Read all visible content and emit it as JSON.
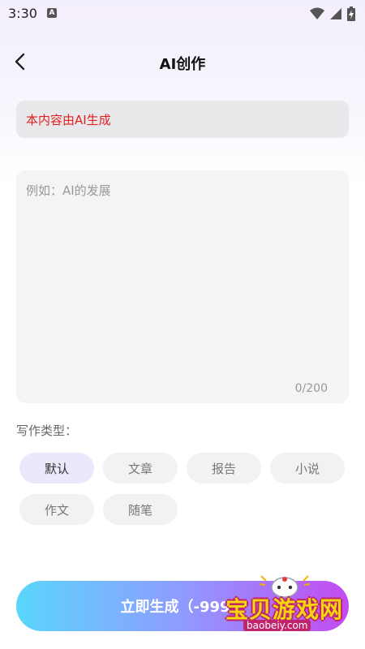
{
  "status": {
    "time": "3:30",
    "a_badge": "A"
  },
  "header": {
    "title": "AI创作"
  },
  "notice": {
    "text": "本内容由AI生成"
  },
  "editor": {
    "placeholder": "例如：AI的发展",
    "value": "",
    "counter": "0/200"
  },
  "writing_type": {
    "label": "写作类型：",
    "options": [
      "默认",
      "文章",
      "报告",
      "小说",
      "作文",
      "随笔"
    ],
    "selected": "默认"
  },
  "generate_button": {
    "label": "立即生成（-999）"
  },
  "watermark": {
    "title": "宝贝游戏网",
    "url": "baobeiy.com"
  },
  "colors": {
    "accent_start": "#5ad6fb",
    "accent_end": "#c24bf1",
    "notice_text": "#e02020",
    "chip_active_bg": "#ece7fb"
  }
}
